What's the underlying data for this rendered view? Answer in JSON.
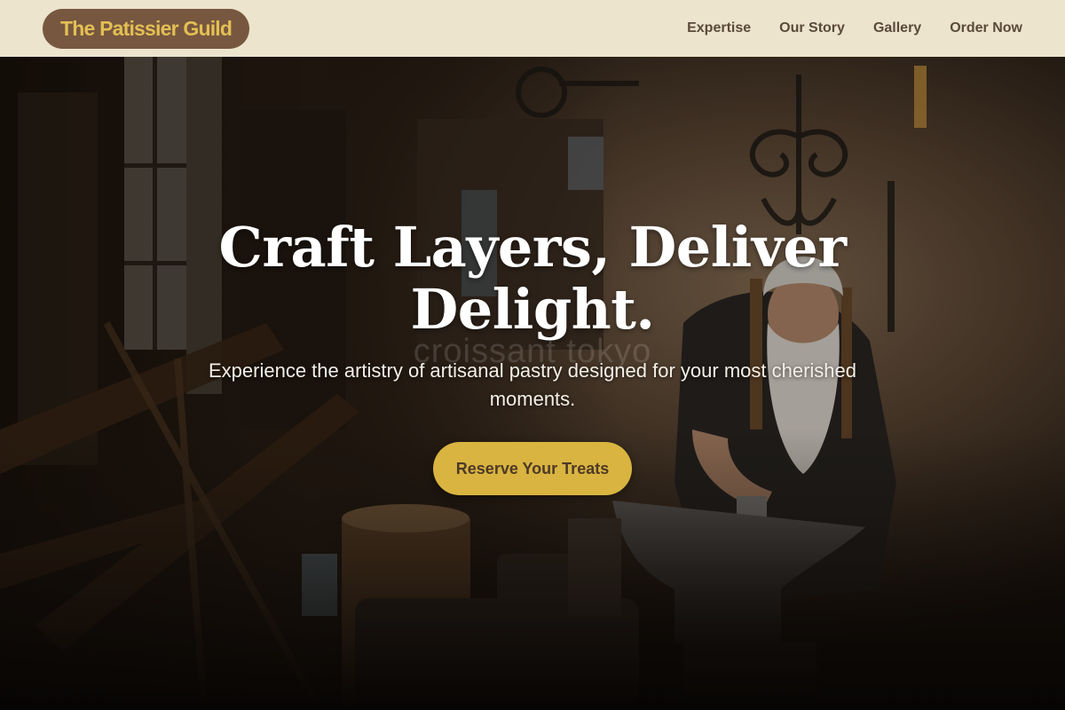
{
  "brand": {
    "name": "The Patissier Guild"
  },
  "nav": {
    "items": [
      {
        "label": "Expertise"
      },
      {
        "label": "Our Story"
      },
      {
        "label": "Gallery"
      },
      {
        "label": "Order Now"
      }
    ]
  },
  "hero": {
    "headline": "Craft Layers, Deliver Delight.",
    "watermark": "croissant tokyo",
    "subtitle": "Experience the artistry of artisanal pastry designed for your most cherished moments.",
    "cta_label": "Reserve Your Treats",
    "image_alt": "Elderly craftsman with a long white beard hammering on an anvil in a dim workshop"
  },
  "colors": {
    "header_bg": "#ece4cd",
    "brand_bg": "#77573f",
    "brand_text": "#e3bf55",
    "nav_text": "#5a4a3a",
    "cta_bg": "#d9b440",
    "cta_text": "#4d3a26",
    "headline_text": "#ffffff"
  }
}
